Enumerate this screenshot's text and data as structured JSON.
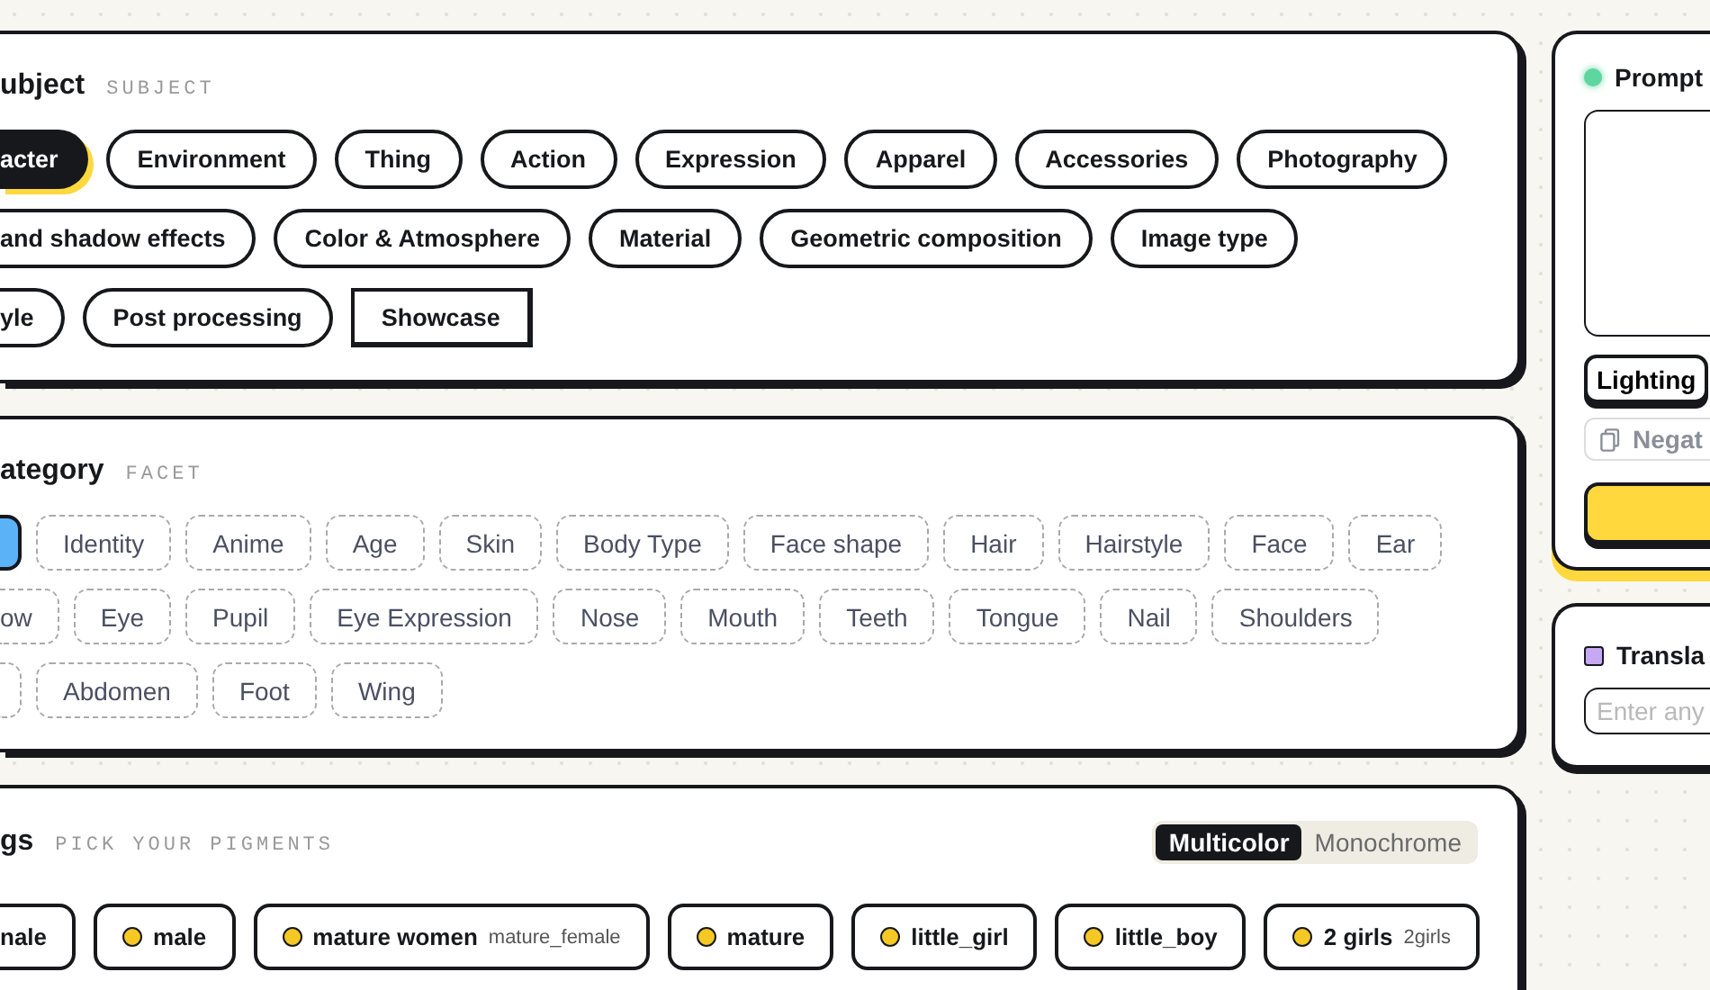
{
  "subject_card": {
    "title": "ubject",
    "subtitle": "SUBJECT",
    "lines": [
      {
        "chips": [
          {
            "label": "acter",
            "kind": "partial",
            "selected": true
          },
          {
            "label": "Environment",
            "kind": "full",
            "selected": false
          },
          {
            "label": "Thing",
            "kind": "full",
            "selected": false
          },
          {
            "label": "Action",
            "kind": "full",
            "selected": false
          },
          {
            "label": "Expression",
            "kind": "full",
            "selected": false
          },
          {
            "label": "Apparel",
            "kind": "full",
            "selected": false
          },
          {
            "label": "Accessories",
            "kind": "full",
            "selected": false
          },
          {
            "label": "Photography",
            "kind": "full",
            "selected": false
          }
        ]
      },
      {
        "chips": [
          {
            "label": "and shadow effects",
            "kind": "partial",
            "selected": false
          },
          {
            "label": "Color & Atmosphere",
            "kind": "full",
            "selected": false
          },
          {
            "label": "Material",
            "kind": "full",
            "selected": false
          },
          {
            "label": "Geometric composition",
            "kind": "full",
            "selected": false
          },
          {
            "label": "Image type",
            "kind": "full",
            "selected": false
          }
        ]
      },
      {
        "chips": [
          {
            "label": "yle",
            "kind": "partial",
            "selected": false
          },
          {
            "label": "Post processing",
            "kind": "full",
            "selected": false
          },
          {
            "label": "Showcase",
            "kind": "square",
            "selected": false
          }
        ]
      }
    ]
  },
  "category_card": {
    "title": "ategory",
    "subtitle": "FACET",
    "lines": [
      {
        "chips": [
          {
            "kind": "partial",
            "selected": true
          },
          {
            "label": "Identity",
            "kind": "full",
            "selected": false
          },
          {
            "label": "Anime",
            "kind": "full",
            "selected": false
          },
          {
            "label": "Age",
            "kind": "full",
            "selected": false
          },
          {
            "label": "Skin",
            "kind": "full",
            "selected": false
          },
          {
            "label": "Body Type",
            "kind": "full",
            "selected": false
          },
          {
            "label": "Face shape",
            "kind": "full",
            "selected": false
          },
          {
            "label": "Hair",
            "kind": "full",
            "selected": false
          },
          {
            "label": "Hairstyle",
            "kind": "full",
            "selected": false
          },
          {
            "label": "Face",
            "kind": "full",
            "selected": false
          },
          {
            "label": "Ear",
            "kind": "full",
            "selected": false
          }
        ]
      },
      {
        "chips": [
          {
            "label": "ow",
            "kind": "partial",
            "selected": false
          },
          {
            "label": "Eye",
            "kind": "full",
            "selected": false
          },
          {
            "label": "Pupil",
            "kind": "full",
            "selected": false
          },
          {
            "label": "Eye Expression",
            "kind": "full",
            "selected": false
          },
          {
            "label": "Nose",
            "kind": "full",
            "selected": false
          },
          {
            "label": "Mouth",
            "kind": "full",
            "selected": false
          },
          {
            "label": "Teeth",
            "kind": "full",
            "selected": false
          },
          {
            "label": "Tongue",
            "kind": "full",
            "selected": false
          },
          {
            "label": "Nail",
            "kind": "full",
            "selected": false
          },
          {
            "label": "Shoulders",
            "kind": "full",
            "selected": false
          }
        ]
      },
      {
        "chips": [
          {
            "kind": "partial",
            "selected": false
          },
          {
            "label": "Abdomen",
            "kind": "full",
            "selected": false
          },
          {
            "label": "Foot",
            "kind": "full",
            "selected": false
          },
          {
            "label": "Wing",
            "kind": "full",
            "selected": false
          }
        ]
      }
    ]
  },
  "tags_card": {
    "title": "gs",
    "subtitle": "PICK YOUR PIGMENTS",
    "modes": [
      {
        "label": "Multicolor",
        "selected": true
      },
      {
        "label": "Monochrome",
        "selected": false
      }
    ],
    "tags": [
      {
        "label": "nale",
        "kind": "partial",
        "dot": false
      },
      {
        "label": "male",
        "kind": "full",
        "dot": true
      },
      {
        "label": "mature women",
        "alias": "mature_female",
        "kind": "full",
        "dot": true
      },
      {
        "label": "mature",
        "kind": "full",
        "dot": true
      },
      {
        "label": "little_girl",
        "kind": "full",
        "dot": true
      },
      {
        "label": "little_boy",
        "kind": "full",
        "dot": true
      },
      {
        "label": "2 girls",
        "alias": "2girls",
        "kind": "full",
        "dot": true
      }
    ]
  },
  "prompt_panel": {
    "title": "Prompt",
    "chip": "Lighting",
    "negative": "Negat"
  },
  "translate_panel": {
    "title": "Transla",
    "placeholder": "Enter any"
  }
}
